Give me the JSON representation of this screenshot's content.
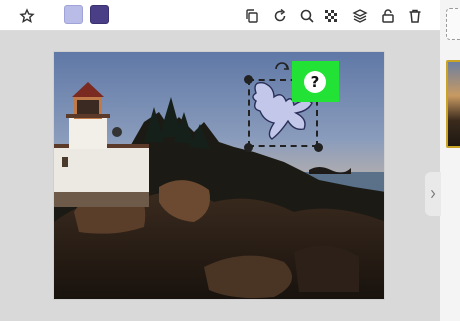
{
  "toolbar": {
    "icons": [
      "sticker-add-icon",
      "duplicate-icon",
      "redo-icon",
      "search-icon",
      "transparency-icon",
      "layers-icon",
      "lock-icon",
      "trash-icon"
    ],
    "swatches": [
      {
        "name": "light-lavender",
        "color": "#b9bce6"
      },
      {
        "name": "dark-purple",
        "color": "#4a3f86"
      }
    ]
  },
  "selection": {
    "help_label": "?"
  },
  "colors": {
    "selection_highlight": "#22e335",
    "thumbnail_border": "#c9a325"
  }
}
